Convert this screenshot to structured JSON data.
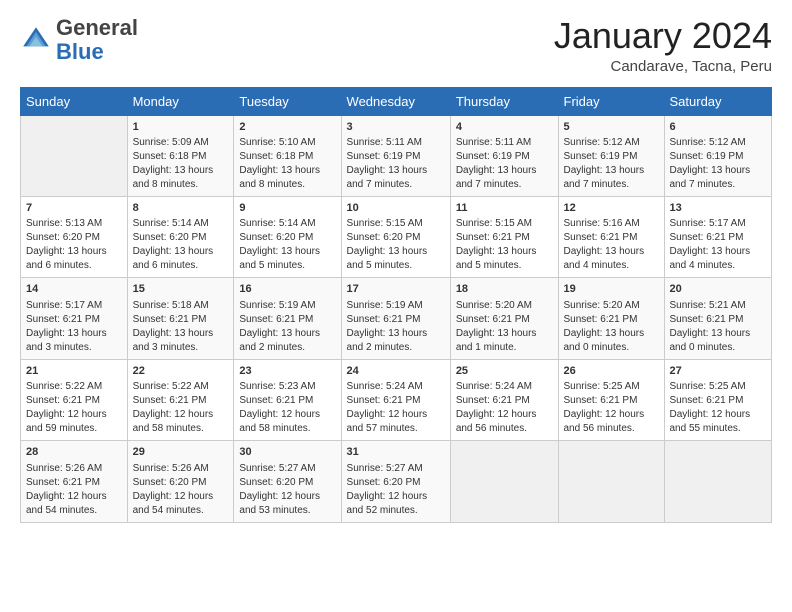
{
  "header": {
    "logo_general": "General",
    "logo_blue": "Blue",
    "month_year": "January 2024",
    "location": "Candarave, Tacna, Peru"
  },
  "days_of_week": [
    "Sunday",
    "Monday",
    "Tuesday",
    "Wednesday",
    "Thursday",
    "Friday",
    "Saturday"
  ],
  "weeks": [
    [
      {
        "day": "",
        "sunrise": "",
        "sunset": "",
        "daylight": ""
      },
      {
        "day": "1",
        "sunrise": "Sunrise: 5:09 AM",
        "sunset": "Sunset: 6:18 PM",
        "daylight": "Daylight: 13 hours and 8 minutes."
      },
      {
        "day": "2",
        "sunrise": "Sunrise: 5:10 AM",
        "sunset": "Sunset: 6:18 PM",
        "daylight": "Daylight: 13 hours and 8 minutes."
      },
      {
        "day": "3",
        "sunrise": "Sunrise: 5:11 AM",
        "sunset": "Sunset: 6:19 PM",
        "daylight": "Daylight: 13 hours and 7 minutes."
      },
      {
        "day": "4",
        "sunrise": "Sunrise: 5:11 AM",
        "sunset": "Sunset: 6:19 PM",
        "daylight": "Daylight: 13 hours and 7 minutes."
      },
      {
        "day": "5",
        "sunrise": "Sunrise: 5:12 AM",
        "sunset": "Sunset: 6:19 PM",
        "daylight": "Daylight: 13 hours and 7 minutes."
      },
      {
        "day": "6",
        "sunrise": "Sunrise: 5:12 AM",
        "sunset": "Sunset: 6:19 PM",
        "daylight": "Daylight: 13 hours and 7 minutes."
      }
    ],
    [
      {
        "day": "7",
        "sunrise": "Sunrise: 5:13 AM",
        "sunset": "Sunset: 6:20 PM",
        "daylight": "Daylight: 13 hours and 6 minutes."
      },
      {
        "day": "8",
        "sunrise": "Sunrise: 5:14 AM",
        "sunset": "Sunset: 6:20 PM",
        "daylight": "Daylight: 13 hours and 6 minutes."
      },
      {
        "day": "9",
        "sunrise": "Sunrise: 5:14 AM",
        "sunset": "Sunset: 6:20 PM",
        "daylight": "Daylight: 13 hours and 5 minutes."
      },
      {
        "day": "10",
        "sunrise": "Sunrise: 5:15 AM",
        "sunset": "Sunset: 6:20 PM",
        "daylight": "Daylight: 13 hours and 5 minutes."
      },
      {
        "day": "11",
        "sunrise": "Sunrise: 5:15 AM",
        "sunset": "Sunset: 6:21 PM",
        "daylight": "Daylight: 13 hours and 5 minutes."
      },
      {
        "day": "12",
        "sunrise": "Sunrise: 5:16 AM",
        "sunset": "Sunset: 6:21 PM",
        "daylight": "Daylight: 13 hours and 4 minutes."
      },
      {
        "day": "13",
        "sunrise": "Sunrise: 5:17 AM",
        "sunset": "Sunset: 6:21 PM",
        "daylight": "Daylight: 13 hours and 4 minutes."
      }
    ],
    [
      {
        "day": "14",
        "sunrise": "Sunrise: 5:17 AM",
        "sunset": "Sunset: 6:21 PM",
        "daylight": "Daylight: 13 hours and 3 minutes."
      },
      {
        "day": "15",
        "sunrise": "Sunrise: 5:18 AM",
        "sunset": "Sunset: 6:21 PM",
        "daylight": "Daylight: 13 hours and 3 minutes."
      },
      {
        "day": "16",
        "sunrise": "Sunrise: 5:19 AM",
        "sunset": "Sunset: 6:21 PM",
        "daylight": "Daylight: 13 hours and 2 minutes."
      },
      {
        "day": "17",
        "sunrise": "Sunrise: 5:19 AM",
        "sunset": "Sunset: 6:21 PM",
        "daylight": "Daylight: 13 hours and 2 minutes."
      },
      {
        "day": "18",
        "sunrise": "Sunrise: 5:20 AM",
        "sunset": "Sunset: 6:21 PM",
        "daylight": "Daylight: 13 hours and 1 minute."
      },
      {
        "day": "19",
        "sunrise": "Sunrise: 5:20 AM",
        "sunset": "Sunset: 6:21 PM",
        "daylight": "Daylight: 13 hours and 0 minutes."
      },
      {
        "day": "20",
        "sunrise": "Sunrise: 5:21 AM",
        "sunset": "Sunset: 6:21 PM",
        "daylight": "Daylight: 13 hours and 0 minutes."
      }
    ],
    [
      {
        "day": "21",
        "sunrise": "Sunrise: 5:22 AM",
        "sunset": "Sunset: 6:21 PM",
        "daylight": "Daylight: 12 hours and 59 minutes."
      },
      {
        "day": "22",
        "sunrise": "Sunrise: 5:22 AM",
        "sunset": "Sunset: 6:21 PM",
        "daylight": "Daylight: 12 hours and 58 minutes."
      },
      {
        "day": "23",
        "sunrise": "Sunrise: 5:23 AM",
        "sunset": "Sunset: 6:21 PM",
        "daylight": "Daylight: 12 hours and 58 minutes."
      },
      {
        "day": "24",
        "sunrise": "Sunrise: 5:24 AM",
        "sunset": "Sunset: 6:21 PM",
        "daylight": "Daylight: 12 hours and 57 minutes."
      },
      {
        "day": "25",
        "sunrise": "Sunrise: 5:24 AM",
        "sunset": "Sunset: 6:21 PM",
        "daylight": "Daylight: 12 hours and 56 minutes."
      },
      {
        "day": "26",
        "sunrise": "Sunrise: 5:25 AM",
        "sunset": "Sunset: 6:21 PM",
        "daylight": "Daylight: 12 hours and 56 minutes."
      },
      {
        "day": "27",
        "sunrise": "Sunrise: 5:25 AM",
        "sunset": "Sunset: 6:21 PM",
        "daylight": "Daylight: 12 hours and 55 minutes."
      }
    ],
    [
      {
        "day": "28",
        "sunrise": "Sunrise: 5:26 AM",
        "sunset": "Sunset: 6:21 PM",
        "daylight": "Daylight: 12 hours and 54 minutes."
      },
      {
        "day": "29",
        "sunrise": "Sunrise: 5:26 AM",
        "sunset": "Sunset: 6:20 PM",
        "daylight": "Daylight: 12 hours and 54 minutes."
      },
      {
        "day": "30",
        "sunrise": "Sunrise: 5:27 AM",
        "sunset": "Sunset: 6:20 PM",
        "daylight": "Daylight: 12 hours and 53 minutes."
      },
      {
        "day": "31",
        "sunrise": "Sunrise: 5:27 AM",
        "sunset": "Sunset: 6:20 PM",
        "daylight": "Daylight: 12 hours and 52 minutes."
      },
      {
        "day": "",
        "sunrise": "",
        "sunset": "",
        "daylight": ""
      },
      {
        "day": "",
        "sunrise": "",
        "sunset": "",
        "daylight": ""
      },
      {
        "day": "",
        "sunrise": "",
        "sunset": "",
        "daylight": ""
      }
    ]
  ]
}
